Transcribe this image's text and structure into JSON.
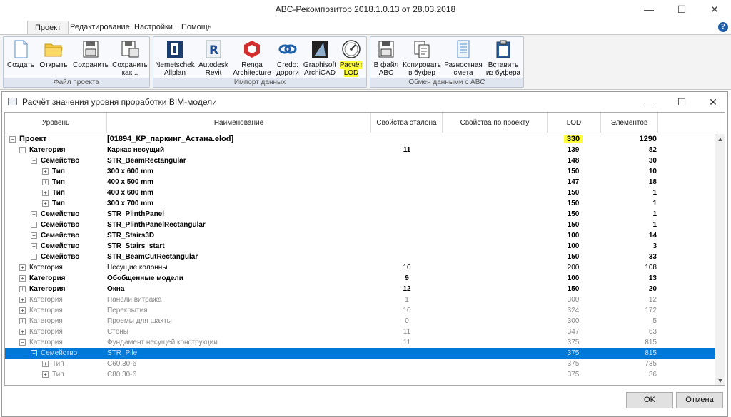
{
  "app": {
    "title": "ABC-Рекомпозитор 2018.1.0.13 от 28.03.2018",
    "controls": {
      "minimize": "—",
      "maximize": "☐",
      "close": "✕"
    }
  },
  "menu": {
    "tabs": [
      {
        "label": "Проект",
        "active": true
      },
      {
        "label": "Редактирование",
        "active": false
      },
      {
        "label": "Настройки",
        "active": false
      },
      {
        "label": "Помощь",
        "active": false
      }
    ],
    "help": "?"
  },
  "ribbon": {
    "groups": [
      {
        "label": "Файл проекта",
        "buttons": [
          {
            "label": "Создать",
            "icon": "new-file-icon"
          },
          {
            "label": "Открыть",
            "icon": "folder-icon"
          },
          {
            "label": "Сохранить",
            "icon": "save-icon"
          },
          {
            "label": "Сохранить как...",
            "icon": "save-as-icon"
          }
        ]
      },
      {
        "label": "Импорт данных",
        "buttons": [
          {
            "label": "Nemetschek Allplan",
            "icon": "allplan-icon"
          },
          {
            "label": "Autodesk Revit",
            "icon": "revit-icon"
          },
          {
            "label": "Renga Architecture",
            "icon": "renga-icon"
          },
          {
            "label": "Credo: дороги",
            "icon": "credo-icon"
          },
          {
            "label": "Graphisoft ArchiCAD",
            "icon": "archicad-icon"
          },
          {
            "label": "Расчёт LOD",
            "icon": "gauge-icon",
            "highlight": true
          }
        ]
      },
      {
        "label": "Обмен данными с ABC",
        "buttons": [
          {
            "label": "В файл ABC",
            "icon": "export-file-icon"
          },
          {
            "label": "Копировать в буфер",
            "icon": "copy-icon"
          },
          {
            "label": "Разностная смета",
            "icon": "estimate-icon"
          },
          {
            "label": "Вставить из буфера",
            "icon": "paste-icon"
          }
        ]
      }
    ]
  },
  "dialog": {
    "title": "Расчёт значения уровня проработки BIM-модели",
    "columns": [
      "Уровень",
      "Наименование",
      "Свойства эталона",
      "Свойства по проекту",
      "LOD",
      "Элементов"
    ],
    "rows": [
      {
        "depth": 0,
        "toggle": "−",
        "level": "Проект",
        "name": "[01894_КР_паркинг_Астана.elod]",
        "etalon": "",
        "lod": "330",
        "elements": "1290",
        "style": "top",
        "lod_highlight": true
      },
      {
        "depth": 1,
        "toggle": "−",
        "level": "Категория",
        "name": "Каркас несущий",
        "etalon": "11",
        "lod": "139",
        "elements": "82",
        "style": "bold"
      },
      {
        "depth": 2,
        "toggle": "−",
        "level": "Семейство",
        "name": "STR_BeamRectangular",
        "etalon": "",
        "lod": "148",
        "elements": "30",
        "style": "bold"
      },
      {
        "depth": 3,
        "toggle": "+",
        "level": "Тип",
        "name": "300 x 600 mm",
        "etalon": "",
        "lod": "150",
        "elements": "10",
        "style": "bold"
      },
      {
        "depth": 3,
        "toggle": "+",
        "level": "Тип",
        "name": "400 x 500 mm",
        "etalon": "",
        "lod": "147",
        "elements": "18",
        "style": "bold"
      },
      {
        "depth": 3,
        "toggle": "+",
        "level": "Тип",
        "name": "400 x 600 mm",
        "etalon": "",
        "lod": "150",
        "elements": "1",
        "style": "bold"
      },
      {
        "depth": 3,
        "toggle": "+",
        "level": "Тип",
        "name": "300 x 700 mm",
        "etalon": "",
        "lod": "150",
        "elements": "1",
        "style": "bold"
      },
      {
        "depth": 2,
        "toggle": "+",
        "level": "Семейство",
        "name": "STR_PlinthPanel",
        "etalon": "",
        "lod": "150",
        "elements": "1",
        "style": "bold"
      },
      {
        "depth": 2,
        "toggle": "+",
        "level": "Семейство",
        "name": "STR_PlinthPanelRectangular",
        "etalon": "",
        "lod": "150",
        "elements": "1",
        "style": "bold"
      },
      {
        "depth": 2,
        "toggle": "+",
        "level": "Семейство",
        "name": "STR_Stairs3D",
        "etalon": "",
        "lod": "100",
        "elements": "14",
        "style": "bold"
      },
      {
        "depth": 2,
        "toggle": "+",
        "level": "Семейство",
        "name": "STR_Stairs_start",
        "etalon": "",
        "lod": "100",
        "elements": "3",
        "style": "bold"
      },
      {
        "depth": 2,
        "toggle": "+",
        "level": "Семейство",
        "name": "STR_BeamCutRectangular",
        "etalon": "",
        "lod": "150",
        "elements": "33",
        "style": "bold"
      },
      {
        "depth": 1,
        "toggle": "+",
        "level": "Категория",
        "name": "Несущие колонны",
        "etalon": "10",
        "lod": "200",
        "elements": "108",
        "style": "normal"
      },
      {
        "depth": 1,
        "toggle": "+",
        "level": "Категория",
        "name": "Обобщенные модели",
        "etalon": "9",
        "lod": "100",
        "elements": "13",
        "style": "bold"
      },
      {
        "depth": 1,
        "toggle": "+",
        "level": "Категория",
        "name": "Окна",
        "etalon": "12",
        "lod": "150",
        "elements": "20",
        "style": "bold"
      },
      {
        "depth": 1,
        "toggle": "+",
        "level": "Категория",
        "name": "Панели витража",
        "etalon": "1",
        "lod": "300",
        "elements": "12",
        "style": "grey"
      },
      {
        "depth": 1,
        "toggle": "+",
        "level": "Категория",
        "name": "Перекрытия",
        "etalon": "10",
        "lod": "324",
        "elements": "172",
        "style": "grey"
      },
      {
        "depth": 1,
        "toggle": "+",
        "level": "Категория",
        "name": "Проемы для шахты",
        "etalon": "0",
        "lod": "300",
        "elements": "5",
        "style": "grey"
      },
      {
        "depth": 1,
        "toggle": "+",
        "level": "Категория",
        "name": "Стены",
        "etalon": "11",
        "lod": "347",
        "elements": "63",
        "style": "grey"
      },
      {
        "depth": 1,
        "toggle": "−",
        "level": "Категория",
        "name": "Фундамент несущей конструкции",
        "etalon": "11",
        "lod": "375",
        "elements": "815",
        "style": "grey"
      },
      {
        "depth": 2,
        "toggle": "−",
        "level": "Семейство",
        "name": "STR_Pile",
        "etalon": "",
        "lod": "375",
        "elements": "815",
        "style": "sel"
      },
      {
        "depth": 3,
        "toggle": "+",
        "level": "Тип",
        "name": "С60.30-6",
        "etalon": "",
        "lod": "375",
        "elements": "735",
        "style": "grey"
      },
      {
        "depth": 3,
        "toggle": "+",
        "level": "Тип",
        "name": "С80.30-6",
        "etalon": "",
        "lod": "375",
        "elements": "36",
        "style": "grey"
      }
    ],
    "ok_label": "OK",
    "cancel_label": "Отмена"
  }
}
